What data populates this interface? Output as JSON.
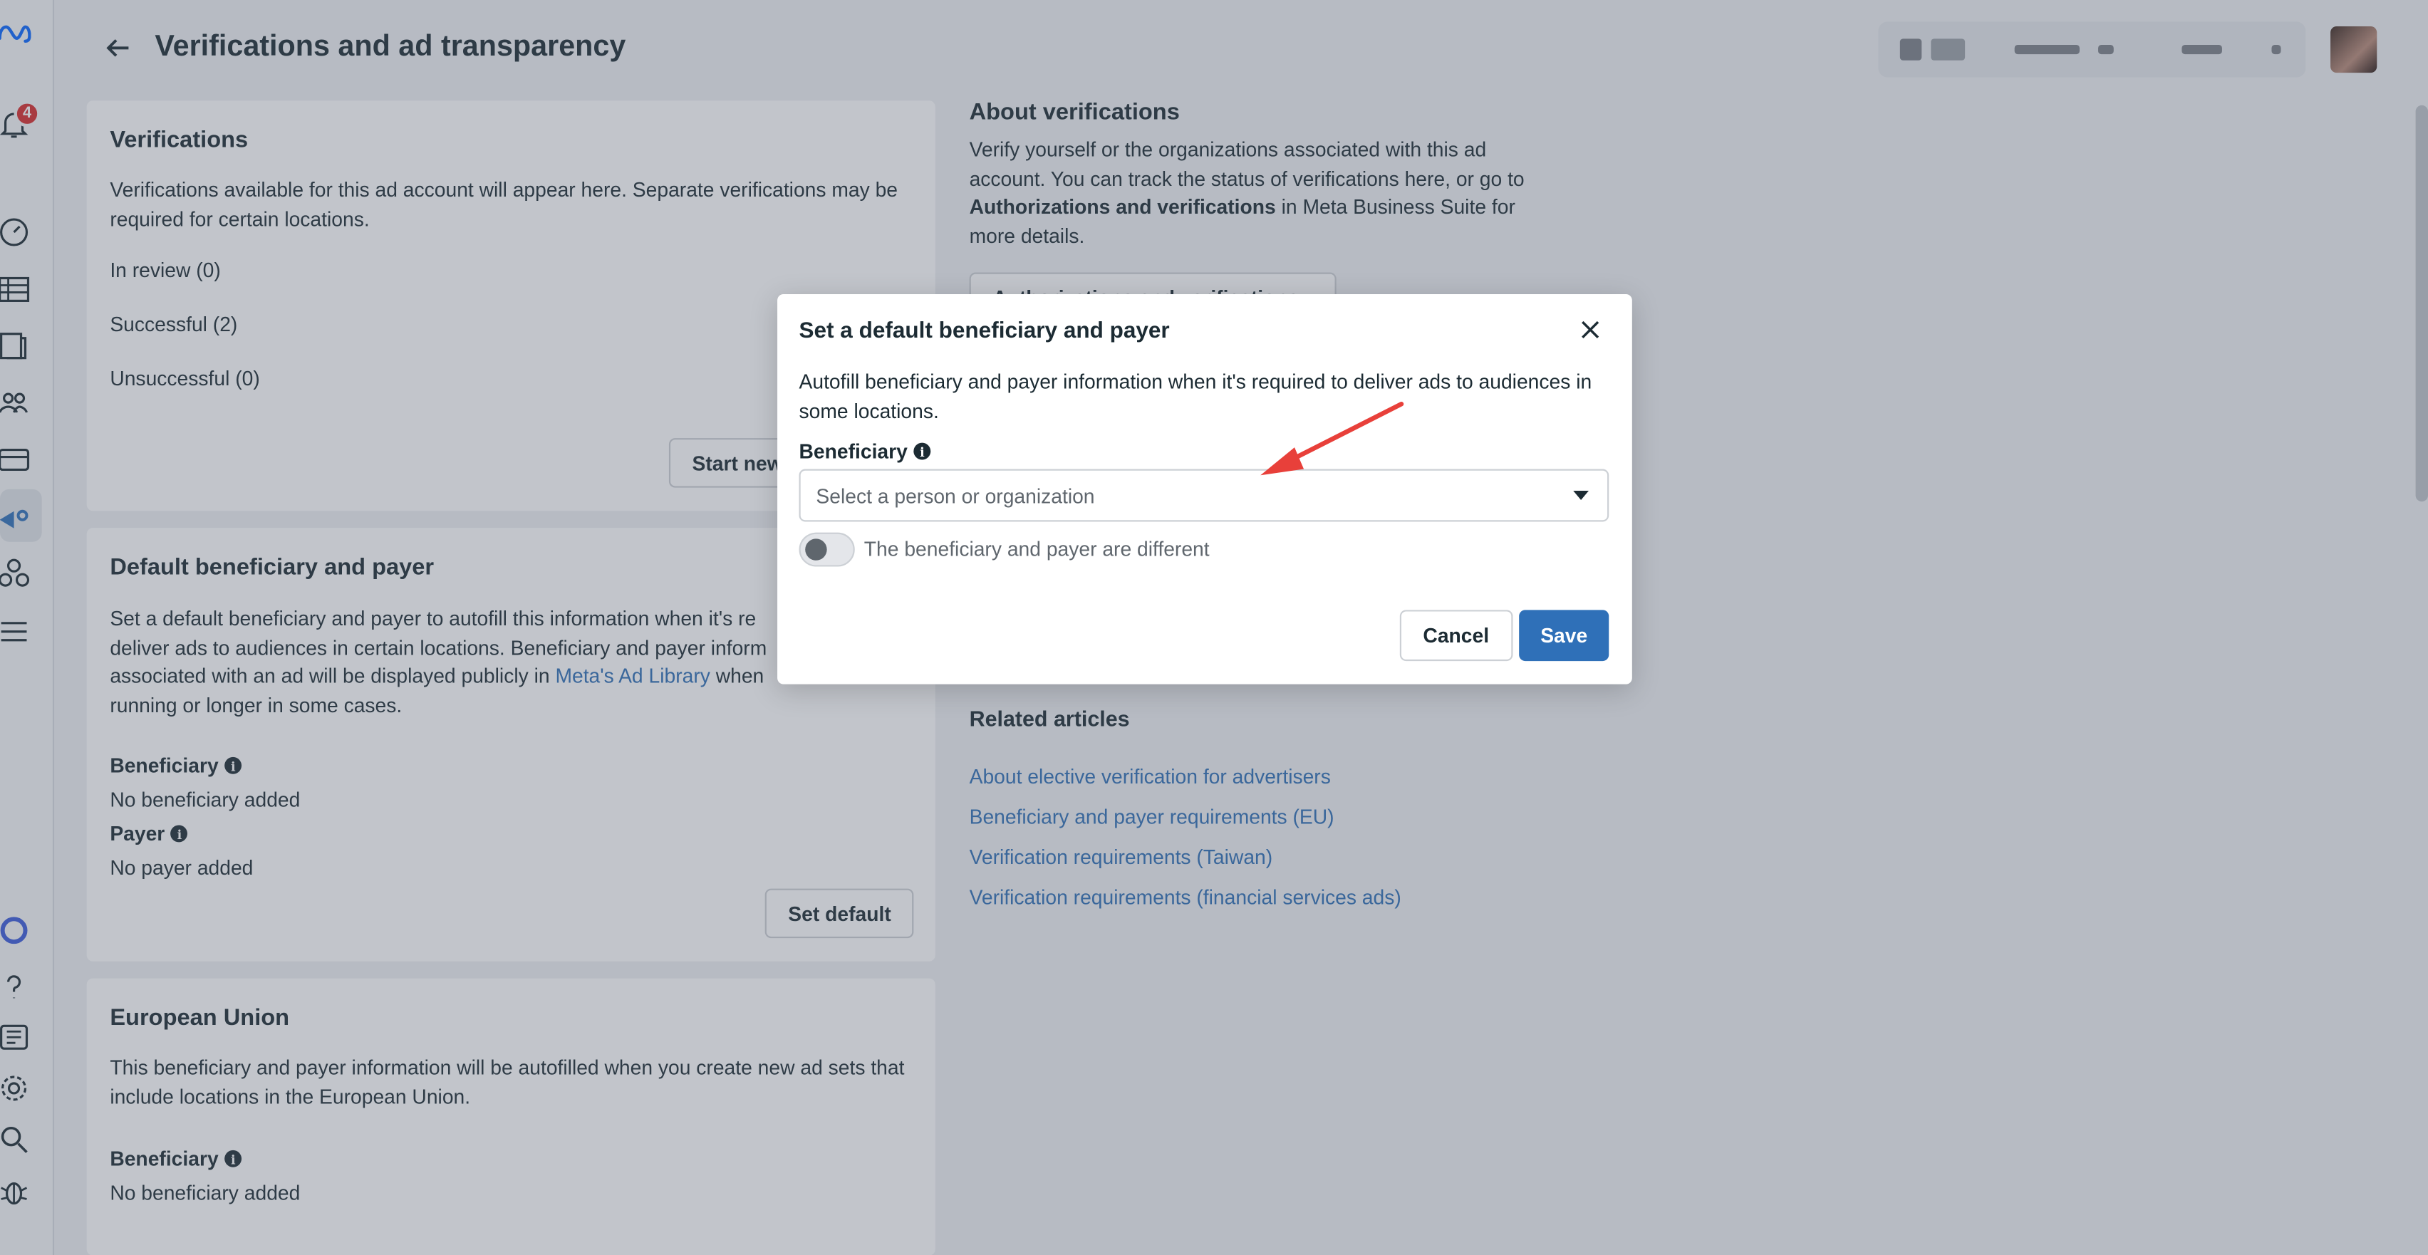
{
  "header": {
    "title": "Verifications and ad transparency"
  },
  "rail": {
    "notification_count": "4"
  },
  "verifications_card": {
    "title": "Verifications",
    "description": "Verifications available for this ad account will appear here. Separate verifications may be required for certain locations.",
    "in_review": "In review (0)",
    "successful": "Successful (2)",
    "unsuccessful": "Unsuccessful (0)",
    "start_button": "Start new"
  },
  "default_card": {
    "title": "Default beneficiary and payer",
    "desc_part1": "Set a default beneficiary and payer to autofill this information when it's re",
    "desc_part2": "deliver ads to audiences in certain locations. Beneficiary and payer inform",
    "desc_part3": "associated with an ad will be displayed publicly in",
    "desc_link": "Meta's Ad Library",
    "desc_part4": " when",
    "desc_part5": "running or longer in some cases.",
    "beneficiary_label": "Beneficiary",
    "beneficiary_value": "No beneficiary added",
    "payer_label": "Payer",
    "payer_value": "No payer added",
    "set_default_button": "Set default"
  },
  "eu_card": {
    "title": "European Union",
    "description": "This beneficiary and payer information will be autofilled when you create new ad sets that include locations in the European Union.",
    "beneficiary_label": "Beneficiary",
    "beneficiary_value": "No beneficiary added"
  },
  "about": {
    "title": "About verifications",
    "text_part1": "Verify yourself or the organizations associated with this ad account. You can track the status of verifications here, or go to ",
    "text_bold": "Authorizations and verifications",
    "text_part2": " in Meta Business Suite for more details.",
    "button": "Authorizations and verifications"
  },
  "related": {
    "title": "Related articles",
    "links": [
      "About elective verification for advertisers",
      "Beneficiary and payer requirements (EU)",
      "Verification requirements (Taiwan)",
      "Verification requirements (financial services ads)"
    ]
  },
  "modal": {
    "title": "Set a default beneficiary and payer",
    "description": "Autofill beneficiary and payer information when it's required to deliver ads to audiences in some locations.",
    "beneficiary_label": "Beneficiary",
    "select_placeholder": "Select a person or organization",
    "toggle_label": "The beneficiary and payer are different",
    "toggle_on": false,
    "cancel": "Cancel",
    "save": "Save"
  },
  "colors": {
    "accent": "#2f70b8",
    "link": "#2f6fb5",
    "annotation_arrow": "#e8403a",
    "badge": "#d82c2c"
  }
}
